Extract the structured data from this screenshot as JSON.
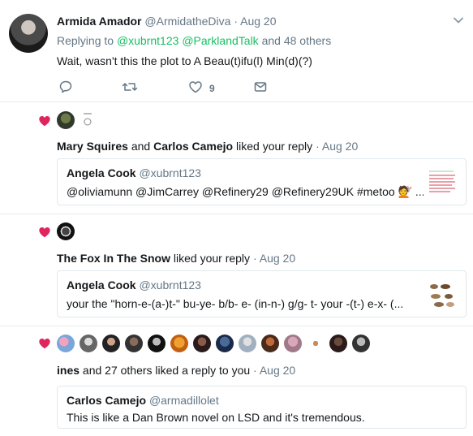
{
  "tweet": {
    "author_name": "Armida Amador",
    "author_handle": "@ArmidatheDiva",
    "time": "Aug 20",
    "replying_to_prefix": "Replying to",
    "replying_to_1": "@xubrnt123",
    "replying_to_2": "@ParklandTalk",
    "replying_to_suffix": "and 48 others",
    "text": "Wait, wasn't this the plot to A Beau(t)ifu(l) Min(d)(?)",
    "like_count": "9",
    "icons": [
      "reply-icon",
      "retweet-icon",
      "like-icon",
      "message-icon",
      "chevron-down-icon"
    ]
  },
  "notifications": [
    {
      "actor_1": "Mary Squires",
      "conj": "and",
      "actor_2": "Carlos Camejo",
      "action": "liked your reply",
      "time": "Aug 20",
      "quote": {
        "name": "Angela Cook",
        "handle": "@xubrnt123",
        "text": "@oliviamunn @JimCarrey @Refinery29 @Refinery29UK #metoo 💇 ..."
      }
    },
    {
      "actor_1": "The Fox In The Snow",
      "action": "liked your reply",
      "time": "Aug 20",
      "quote": {
        "name": "Angela Cook",
        "handle": "@xubrnt123",
        "text": "your the \"horn-e-(a-)t-\" bu-ye- b/b- e- (in-n-) g/g- t- your -(t-) e-x- (..."
      }
    },
    {
      "actor_1": "ines",
      "action": "and 27 others liked a reply to you",
      "time": "Aug 20",
      "quote": {
        "name": "Carlos Camejo",
        "handle": "@armadillolet",
        "text": "This is like a Dan Brown novel on LSD and it's tremendous."
      }
    }
  ],
  "colors": {
    "accent": "#1da1f2",
    "mention": "#17bf63",
    "heart": "#e0245e",
    "muted": "#657786"
  }
}
